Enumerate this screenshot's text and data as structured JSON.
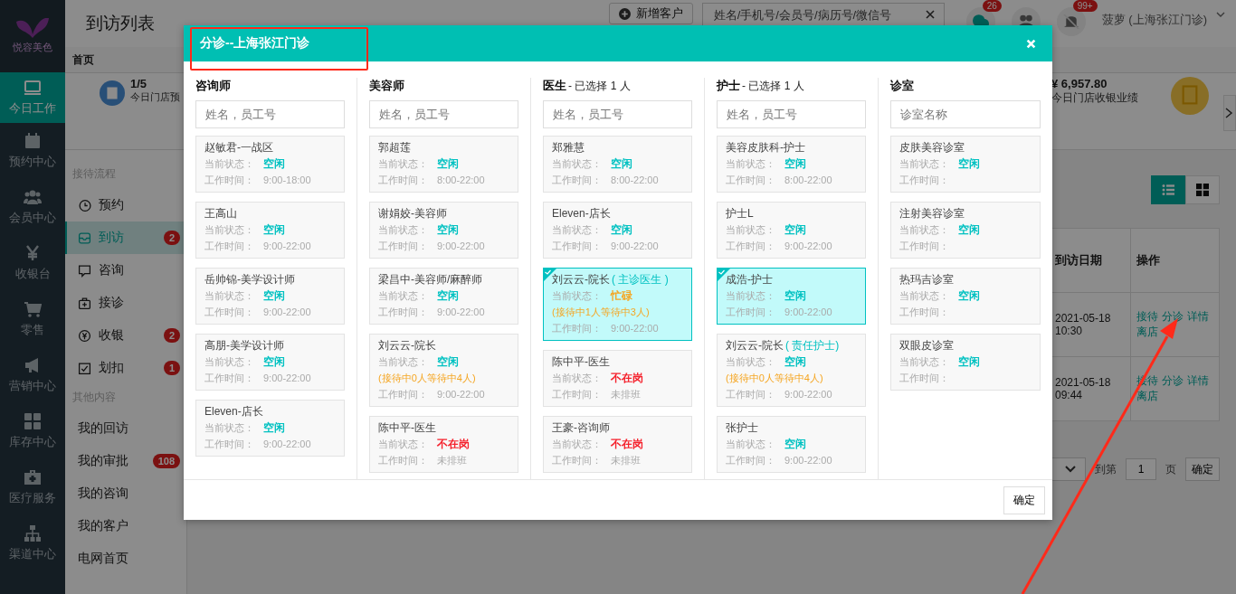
{
  "app": {
    "logo_text": "悦容美色",
    "nav": [
      {
        "label": "今日工作",
        "selected": true
      },
      {
        "label": "预约中心",
        "selected": false
      },
      {
        "label": "会员中心",
        "selected": false
      },
      {
        "label": "收银台",
        "selected": false
      },
      {
        "label": "零售",
        "selected": false
      },
      {
        "label": "营销中心",
        "selected": false
      },
      {
        "label": "库存中心",
        "selected": false
      },
      {
        "label": "医疗服务",
        "selected": false
      },
      {
        "label": "渠道中心",
        "selected": false
      }
    ]
  },
  "header": {
    "title": "到访列表",
    "new_button": "新增客户",
    "search": {
      "placeholder": "姓名/手机号/会员号/病历号/微信号"
    },
    "message_badge": "26",
    "alert_badge": "99+",
    "user": "菠萝 (上海张江门诊)"
  },
  "tabs": [
    {
      "label": "首页"
    }
  ],
  "sidebar": {
    "sections": [
      {
        "title": "接待流程",
        "items": [
          {
            "label": "预约",
            "selected": false
          },
          {
            "label": "到访",
            "badge": "2",
            "selected": true
          },
          {
            "label": "咨询",
            "selected": false
          },
          {
            "label": "接诊",
            "selected": false
          },
          {
            "label": "收银",
            "badge": "2",
            "selected": false
          },
          {
            "label": "划扣",
            "badge": "1",
            "selected": false
          }
        ]
      },
      {
        "title": "其他内容",
        "items": [
          {
            "label": "我的回访",
            "selected": false
          },
          {
            "label": "我的审批",
            "badge": "108",
            "selected": false
          },
          {
            "label": "我的咨询",
            "selected": false
          },
          {
            "label": "我的客户",
            "selected": false
          },
          {
            "label": "电网首页",
            "selected": false
          }
        ]
      }
    ]
  },
  "stats": [
    {
      "value": "1/5",
      "label": "今日门店预"
    },
    {
      "value": "¥ 6,957.80",
      "label": "今日门店收银业绩"
    }
  ],
  "view_toggle": [
    {
      "selected": true
    },
    {
      "selected": false
    }
  ],
  "table": {
    "columns": [
      "到访日期",
      "操作"
    ],
    "rows": [
      {
        "date": "2021-05-18 10:30",
        "actions": [
          "接待",
          "分诊",
          "详情",
          "离店"
        ]
      },
      {
        "date": "2021-05-18 09:44",
        "actions": [
          "接待",
          "分诊",
          "详情",
          "离店"
        ]
      }
    ]
  },
  "pagination": {
    "goto_label": "到第",
    "page": "1",
    "page_suffix": "页",
    "confirm": "确定"
  },
  "modal": {
    "title": "分诊--上海张江门诊",
    "confirm": "确定",
    "columns": [
      {
        "title": "咨询师",
        "placeholder": "姓名，员工号",
        "cards": [
          {
            "name": "赵敏君-一战区",
            "status_label": "当前状态：",
            "status": {
              "text": "空闲",
              "color": "#00c1c1"
            },
            "hours_label": "工作时间：",
            "hours": "9:00-18:00",
            "selected": false
          },
          {
            "name": "王高山",
            "status_label": "当前状态：",
            "status": {
              "text": "空闲",
              "color": "#00c1c1"
            },
            "hours_label": "工作时间：",
            "hours": "9:00-22:00",
            "selected": false
          },
          {
            "name": "岳帅锦-美学设计师",
            "status_label": "当前状态：",
            "status": {
              "text": "空闲",
              "color": "#00c1c1"
            },
            "hours_label": "工作时间：",
            "hours": "9:00-22:00",
            "selected": false
          },
          {
            "name": "高朋-美学设计师",
            "status_label": "当前状态：",
            "status": {
              "text": "空闲",
              "color": "#00c1c1"
            },
            "hours_label": "工作时间：",
            "hours": "9:00-22:00",
            "selected": false
          },
          {
            "name": "Eleven-店长",
            "status_label": "当前状态：",
            "status": {
              "text": "空闲",
              "color": "#00c1c1"
            },
            "hours_label": "工作时间：",
            "hours": "9:00-22:00",
            "selected": false
          }
        ]
      },
      {
        "title": "美容师",
        "placeholder": "姓名，员工号",
        "cards": [
          {
            "name": "郭超莲",
            "status_label": "当前状态：",
            "status": {
              "text": "空闲",
              "color": "#00c1c1"
            },
            "hours_label": "工作时间：",
            "hours": "8:00-22:00",
            "selected": false
          },
          {
            "name": "谢娟姣-美容师",
            "status_label": "当前状态：",
            "status": {
              "text": "空闲",
              "color": "#00c1c1"
            },
            "hours_label": "工作时间：",
            "hours": "9:00-22:00",
            "selected": false
          },
          {
            "name": "梁昌中-美容师/麻醉师",
            "status_label": "当前状态：",
            "status": {
              "text": "空闲",
              "color": "#00c1c1"
            },
            "hours_label": "工作时间：",
            "hours": "9:00-22:00",
            "selected": false
          },
          {
            "name": "刘云云-院长",
            "status_label": "当前状态：",
            "status": {
              "text": "空闲",
              "color": "#00c1c1"
            },
            "queue": "(接待中0人等待中4人)",
            "hours_label": "工作时间：",
            "hours": "9:00-22:00",
            "selected": false
          },
          {
            "name": "陈中平-医生",
            "status_label": "当前状态：",
            "status": {
              "text": "不在岗",
              "color": "#f5222d"
            },
            "hours_label": "工作时间：",
            "hours": "未排班",
            "selected": false
          }
        ]
      },
      {
        "title": "医生",
        "note": "- 已选择 1 人",
        "placeholder": "姓名，员工号",
        "cards": [
          {
            "name": "郑雅慧",
            "status_label": "当前状态：",
            "status": {
              "text": "空闲",
              "color": "#00c1c1"
            },
            "hours_label": "工作时间：",
            "hours": "8:00-22:00",
            "selected": false
          },
          {
            "name": "Eleven-店长",
            "status_label": "当前状态：",
            "status": {
              "text": "空闲",
              "color": "#00c1c1"
            },
            "hours_label": "工作时间：",
            "hours": "9:00-22:00",
            "selected": false
          },
          {
            "name": "刘云云-院长",
            "role": "( 主诊医生 )",
            "status_label": "当前状态：",
            "status": {
              "text": "忙碌",
              "color": "#f5a623"
            },
            "queue": "(接待中1人等待中3人)",
            "hours_label": "工作时间：",
            "hours": "9:00-22:00",
            "selected": true
          },
          {
            "name": "陈中平-医生",
            "status_label": "当前状态：",
            "status": {
              "text": "不在岗",
              "color": "#f5222d"
            },
            "hours_label": "工作时间：",
            "hours": "未排班",
            "selected": false
          },
          {
            "name": "王豪-咨询师",
            "status_label": "当前状态：",
            "status": {
              "text": "不在岗",
              "color": "#f5222d"
            },
            "hours_label": "工作时间：",
            "hours": "未排班",
            "selected": false
          }
        ]
      },
      {
        "title": "护士",
        "note": "- 已选择 1 人",
        "placeholder": "姓名，员工号",
        "cards": [
          {
            "name": "美容皮肤科-护士",
            "status_label": "当前状态：",
            "status": {
              "text": "空闲",
              "color": "#00c1c1"
            },
            "hours_label": "工作时间：",
            "hours": "8:00-22:00",
            "selected": false
          },
          {
            "name": "护士L",
            "status_label": "当前状态：",
            "status": {
              "text": "空闲",
              "color": "#00c1c1"
            },
            "hours_label": "工作时间：",
            "hours": "9:00-22:00",
            "selected": false
          },
          {
            "name": "成浩-护士",
            "status_label": "当前状态：",
            "status": {
              "text": "空闲",
              "color": "#00c1c1"
            },
            "hours_label": "工作时间：",
            "hours": "9:00-22:00",
            "selected": true
          },
          {
            "name": "刘云云-院长",
            "role": "( 责任护士)",
            "status_label": "当前状态：",
            "status": {
              "text": "空闲",
              "color": "#00c1c1"
            },
            "queue": "(接待中0人等待中4人)",
            "hours_label": "工作时间：",
            "hours": "9:00-22:00",
            "selected": false
          },
          {
            "name": "张护士",
            "status_label": "当前状态：",
            "status": {
              "text": "空闲",
              "color": "#00c1c1"
            },
            "hours_label": "工作时间：",
            "hours": "9:00-22:00",
            "selected": false
          }
        ]
      },
      {
        "title": "诊室",
        "placeholder": "诊室名称",
        "cards": [
          {
            "name": "皮肤美容诊室",
            "status_label": "当前状态：",
            "status": {
              "text": "空闲",
              "color": "#00c1c1"
            },
            "hours_label": "工作时间：",
            "selected": false
          },
          {
            "name": "注射美容诊室",
            "status_label": "当前状态：",
            "status": {
              "text": "空闲",
              "color": "#00c1c1"
            },
            "hours_label": "工作时间：",
            "selected": false
          },
          {
            "name": "热玛吉诊室",
            "status_label": "当前状态：",
            "status": {
              "text": "空闲",
              "color": "#00c1c1"
            },
            "hours_label": "工作时间：",
            "selected": false
          },
          {
            "name": "双眼皮诊室",
            "status_label": "当前状态：",
            "status": {
              "text": "空闲",
              "color": "#00c1c1"
            },
            "hours_label": "工作时间：",
            "selected": false
          }
        ]
      }
    ]
  }
}
